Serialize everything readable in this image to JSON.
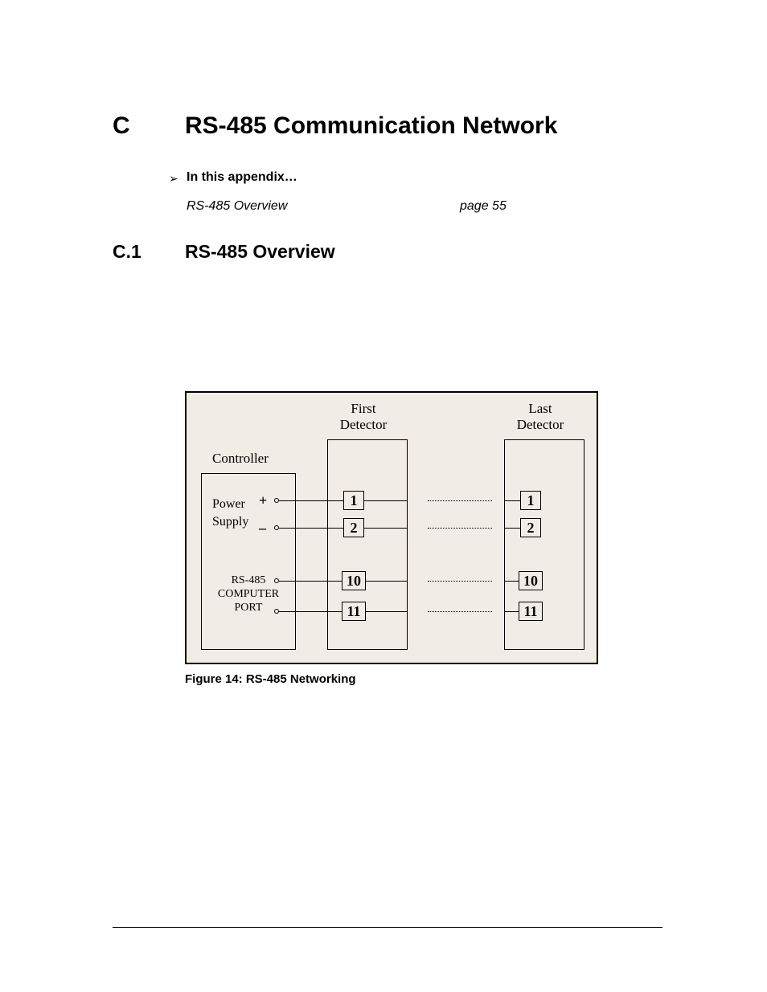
{
  "heading": {
    "letter": "C",
    "title": "RS-485 Communication Network"
  },
  "lead": {
    "bullet": "➢",
    "text": "In this appendix…"
  },
  "toc": {
    "item": "RS-485 Overview",
    "page": "page 55"
  },
  "section": {
    "num": "C.1",
    "title": "RS-485 Overview"
  },
  "figure": {
    "caption": "Figure 14: RS-485 Networking",
    "labels": {
      "first_detector_l1": "First",
      "first_detector_l2": "Detector",
      "last_detector_l1": "Last",
      "last_detector_l2": "Detector",
      "controller": "Controller",
      "power": "Power",
      "supply": "Supply",
      "rs485_l1": "RS-485",
      "rs485_l2": "COMPUTER",
      "rs485_l3": "PORT",
      "plus": "+",
      "minus": "–"
    },
    "pins": {
      "p1": "1",
      "p2": "2",
      "p10": "10",
      "p11": "11"
    }
  }
}
